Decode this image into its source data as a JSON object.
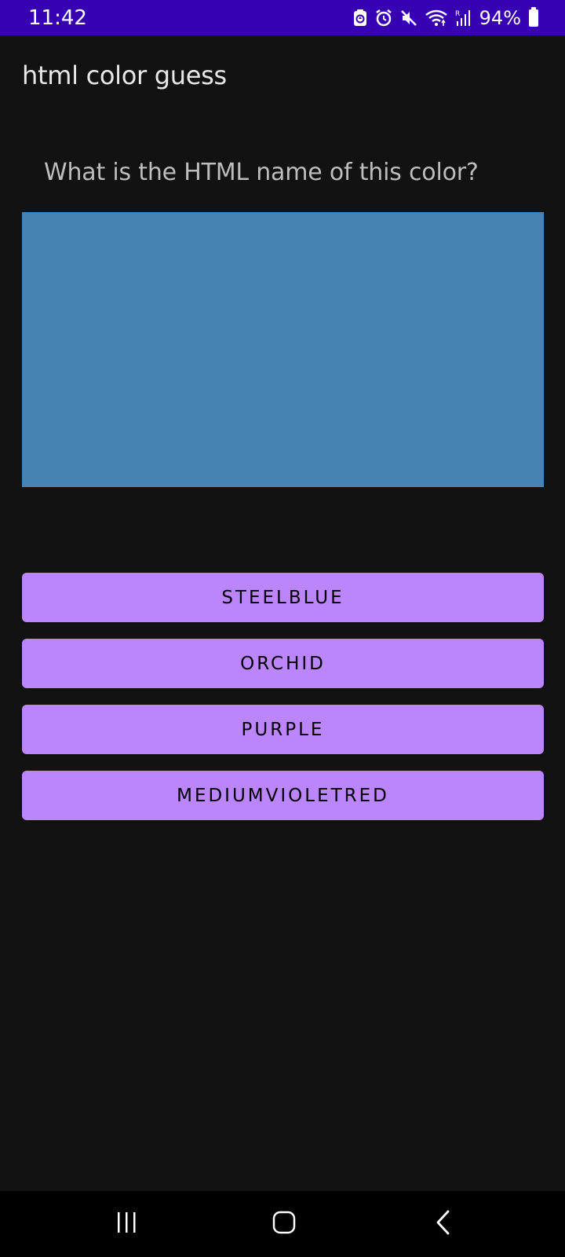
{
  "status_bar": {
    "time": "11:42",
    "battery_percent": "94%",
    "icons": [
      "android-auto-icon",
      "alarm-icon",
      "mute-icon",
      "wifi-icon",
      "signal-icon",
      "battery-icon"
    ],
    "background": "#3700b3"
  },
  "app": {
    "title": "html color guess"
  },
  "quiz": {
    "question": "What is the HTML name of this color?",
    "swatch_color": "#4682b4",
    "options": [
      {
        "label": "STEELBLUE"
      },
      {
        "label": "ORCHID"
      },
      {
        "label": "PURPLE"
      },
      {
        "label": "MEDIUMVIOLETRED"
      }
    ]
  },
  "colors": {
    "background": "#121212",
    "button": "#bb86fc",
    "button_text": "#000000"
  },
  "nav_bar": {
    "buttons": [
      "recents-icon",
      "home-icon",
      "back-icon"
    ]
  }
}
